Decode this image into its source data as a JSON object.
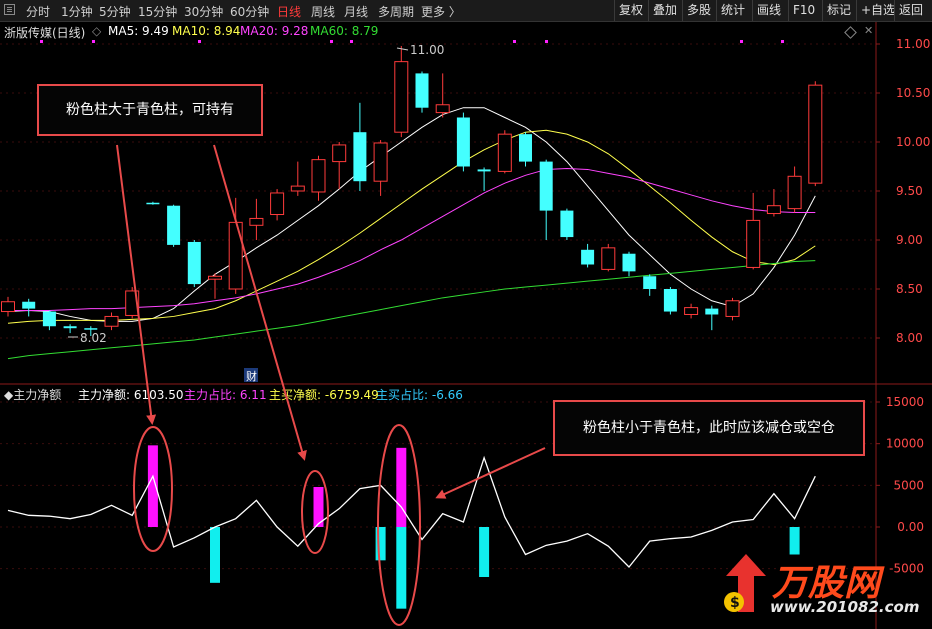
{
  "toolbar": {
    "timeframes": [
      "分时",
      "1分钟",
      "5分钟",
      "15分钟",
      "30分钟",
      "60分钟",
      "日线",
      "周线",
      "月线",
      "多周期",
      "更多 〉"
    ],
    "active_timeframe": "日线",
    "tools": [
      "复权",
      "叠加",
      "多股",
      "统计",
      "画线",
      "F10",
      "标记",
      "+自选",
      "返回"
    ]
  },
  "price_panel": {
    "title": "浙版传媒(日线)",
    "ma": [
      {
        "label": "MA5: 9.49",
        "color": "#ffffff"
      },
      {
        "label": "MA10: 8.94",
        "color": "#ffff4d"
      },
      {
        "label": "MA20: 9.28",
        "color": "#ff44ff"
      },
      {
        "label": "MA60: 8.79",
        "color": "#33dd33"
      }
    ],
    "axis_ticks": [
      "11.00",
      "10.50",
      "10.00",
      "9.50",
      "9.00",
      "8.50",
      "8.00"
    ],
    "high_marker": "11.00",
    "low_marker": "8.02",
    "event_marks": [
      "财"
    ]
  },
  "indicator_panel": {
    "title": "主力净额",
    "values": [
      {
        "label": "主力净额: 6103.50",
        "color": "#ffffff"
      },
      {
        "label": "主力占比: 6.11",
        "color": "#ff44ff"
      },
      {
        "label": "主买净额: -6759.49",
        "color": "#ffff4d"
      },
      {
        "label": "主买占比: -6.66",
        "color": "#33ccff"
      }
    ],
    "axis_ticks": [
      "15000",
      "10000",
      "5000",
      "0.00",
      "-5000"
    ]
  },
  "annotations": {
    "hold_text": "粉色柱大于青色柱，可持有",
    "reduce_text": "粉色柱小于青色柱，此时应该减仓或空仓"
  },
  "watermark": {
    "brand": "万股网",
    "url": "www.201082.com"
  },
  "colors": {
    "up": "#ff3b3b",
    "down": "#44ffff",
    "pink": "#ff11ff",
    "cyan": "#11eeee",
    "annotation": "#e84a4a"
  },
  "chart_data": {
    "type": "candlestick",
    "title": "浙版传媒(日线)",
    "ylim": [
      7.7,
      11.1
    ],
    "candles": [
      {
        "o": 8.27,
        "c": 8.37,
        "h": 8.42,
        "l": 8.22
      },
      {
        "o": 8.37,
        "c": 8.3,
        "h": 8.4,
        "l": 8.22
      },
      {
        "o": 8.27,
        "c": 8.12,
        "h": 8.28,
        "l": 8.08
      },
      {
        "o": 8.12,
        "c": 8.1,
        "h": 8.14,
        "l": 8.05
      },
      {
        "o": 8.1,
        "c": 8.09,
        "h": 8.12,
        "l": 8.02
      },
      {
        "o": 8.12,
        "c": 8.22,
        "h": 8.26,
        "l": 8.08
      },
      {
        "o": 8.23,
        "c": 8.48,
        "h": 8.52,
        "l": 8.2
      },
      {
        "o": 9.38,
        "c": 9.37,
        "h": 9.39,
        "l": 9.36
      },
      {
        "o": 9.35,
        "c": 8.95,
        "h": 9.36,
        "l": 8.93
      },
      {
        "o": 8.98,
        "c": 8.55,
        "h": 9.0,
        "l": 8.52
      },
      {
        "o": 8.6,
        "c": 8.63,
        "h": 8.66,
        "l": 8.4
      },
      {
        "o": 8.5,
        "c": 9.18,
        "h": 9.43,
        "l": 8.45
      },
      {
        "o": 9.15,
        "c": 9.22,
        "h": 9.42,
        "l": 9.0
      },
      {
        "o": 9.26,
        "c": 9.48,
        "h": 9.52,
        "l": 9.2
      },
      {
        "o": 9.5,
        "c": 9.55,
        "h": 9.8,
        "l": 9.45
      },
      {
        "o": 9.49,
        "c": 9.82,
        "h": 9.86,
        "l": 9.4
      },
      {
        "o": 9.8,
        "c": 9.97,
        "h": 10.0,
        "l": 9.52
      },
      {
        "o": 10.1,
        "c": 9.6,
        "h": 10.4,
        "l": 9.5
      },
      {
        "o": 9.6,
        "c": 9.99,
        "h": 10.02,
        "l": 9.45
      },
      {
        "o": 10.1,
        "c": 10.82,
        "h": 10.98,
        "l": 10.05
      },
      {
        "o": 10.7,
        "c": 10.35,
        "h": 10.72,
        "l": 10.3
      },
      {
        "o": 10.3,
        "c": 10.38,
        "h": 10.7,
        "l": 10.25
      },
      {
        "o": 10.25,
        "c": 9.75,
        "h": 10.3,
        "l": 9.7
      },
      {
        "o": 9.72,
        "c": 9.7,
        "h": 9.74,
        "l": 9.5
      },
      {
        "o": 9.7,
        "c": 10.08,
        "h": 10.12,
        "l": 9.68
      },
      {
        "o": 10.08,
        "c": 9.8,
        "h": 10.1,
        "l": 9.75
      },
      {
        "o": 9.8,
        "c": 9.3,
        "h": 9.82,
        "l": 9.0
      },
      {
        "o": 9.3,
        "c": 9.03,
        "h": 9.32,
        "l": 9.0
      },
      {
        "o": 8.9,
        "c": 8.75,
        "h": 8.96,
        "l": 8.72
      },
      {
        "o": 8.7,
        "c": 8.92,
        "h": 8.96,
        "l": 8.68
      },
      {
        "o": 8.86,
        "c": 8.68,
        "h": 8.88,
        "l": 8.63
      },
      {
        "o": 8.63,
        "c": 8.5,
        "h": 8.65,
        "l": 8.43
      },
      {
        "o": 8.5,
        "c": 8.27,
        "h": 8.52,
        "l": 8.24
      },
      {
        "o": 8.24,
        "c": 8.31,
        "h": 8.35,
        "l": 8.2
      },
      {
        "o": 8.3,
        "c": 8.24,
        "h": 8.33,
        "l": 8.08
      },
      {
        "o": 8.22,
        "c": 8.38,
        "h": 8.41,
        "l": 8.18
      },
      {
        "o": 8.72,
        "c": 9.2,
        "h": 9.48,
        "l": 8.7
      },
      {
        "o": 9.27,
        "c": 9.35,
        "h": 9.52,
        "l": 9.24
      },
      {
        "o": 9.32,
        "c": 9.65,
        "h": 9.75,
        "l": 9.28
      },
      {
        "o": 9.58,
        "c": 10.58,
        "h": 10.62,
        "l": 9.55
      }
    ],
    "ma": {
      "MA5": [
        8.27,
        8.28,
        8.27,
        8.22,
        8.18,
        8.17,
        8.17,
        8.2,
        8.3,
        8.48,
        8.65,
        8.78,
        8.92,
        9.05,
        9.2,
        9.35,
        9.52,
        9.7,
        9.85,
        10.0,
        10.15,
        10.28,
        10.35,
        10.35,
        10.25,
        10.15,
        10.0,
        9.8,
        9.55,
        9.3,
        9.05,
        8.85,
        8.65,
        8.5,
        8.38,
        8.32,
        8.45,
        8.72,
        9.05,
        9.45
      ],
      "MA10": [
        8.15,
        8.17,
        8.18,
        8.18,
        8.18,
        8.18,
        8.19,
        8.2,
        8.22,
        8.26,
        8.3,
        8.38,
        8.48,
        8.58,
        8.68,
        8.8,
        8.93,
        9.07,
        9.22,
        9.37,
        9.52,
        9.66,
        9.8,
        9.92,
        10.02,
        10.1,
        10.12,
        10.08,
        10.0,
        9.88,
        9.72,
        9.55,
        9.38,
        9.2,
        9.03,
        8.88,
        8.78,
        8.75,
        8.8,
        8.94
      ],
      "MA20": [
        8.28,
        8.28,
        8.28,
        8.29,
        8.3,
        8.3,
        8.31,
        8.32,
        8.33,
        8.35,
        8.38,
        8.41,
        8.45,
        8.5,
        8.55,
        8.62,
        8.7,
        8.79,
        8.9,
        9.0,
        9.12,
        9.24,
        9.36,
        9.48,
        9.58,
        9.66,
        9.72,
        9.73,
        9.72,
        9.68,
        9.64,
        9.58,
        9.52,
        9.46,
        9.4,
        9.35,
        9.31,
        9.29,
        9.28,
        9.28
      ],
      "MA60": [
        7.79,
        7.82,
        7.84,
        7.86,
        7.88,
        7.9,
        7.92,
        7.94,
        7.96,
        7.98,
        8.01,
        8.04,
        8.07,
        8.1,
        8.13,
        8.17,
        8.21,
        8.25,
        8.29,
        8.33,
        8.37,
        8.41,
        8.44,
        8.47,
        8.5,
        8.52,
        8.54,
        8.56,
        8.58,
        8.6,
        8.62,
        8.64,
        8.66,
        8.68,
        8.7,
        8.72,
        8.74,
        8.76,
        8.78,
        8.79
      ]
    },
    "indicator": {
      "name": "主力净额",
      "ylim": [
        -10000,
        15500
      ],
      "line": [
        2000,
        1400,
        1300,
        1000,
        1500,
        2600,
        1400,
        6100,
        -2400,
        -1300,
        0,
        1000,
        3200,
        0,
        -2300,
        400,
        2200,
        4600,
        5000,
        2400,
        -1500,
        1600,
        600,
        8300,
        1200,
        -3300,
        -2200,
        -1700,
        -800,
        -2300,
        -4800,
        -1700,
        -1400,
        -1200,
        -400,
        600,
        900,
        4000,
        1000,
        6100
      ],
      "pink": [
        null,
        null,
        null,
        null,
        null,
        null,
        null,
        9800,
        null,
        null,
        null,
        null,
        null,
        null,
        null,
        4800,
        null,
        null,
        null,
        9500,
        null,
        null,
        null,
        null,
        null,
        null,
        null,
        null,
        null,
        null,
        null,
        null,
        null,
        null,
        null,
        null,
        null,
        null,
        null,
        null
      ],
      "cyan": [
        null,
        null,
        null,
        null,
        null,
        null,
        null,
        null,
        null,
        null,
        -6700,
        null,
        null,
        null,
        null,
        null,
        null,
        null,
        -4000,
        -9800,
        null,
        null,
        null,
        -6000,
        null,
        null,
        null,
        null,
        null,
        null,
        null,
        null,
        null,
        null,
        null,
        null,
        null,
        null,
        -3300,
        null
      ]
    }
  }
}
